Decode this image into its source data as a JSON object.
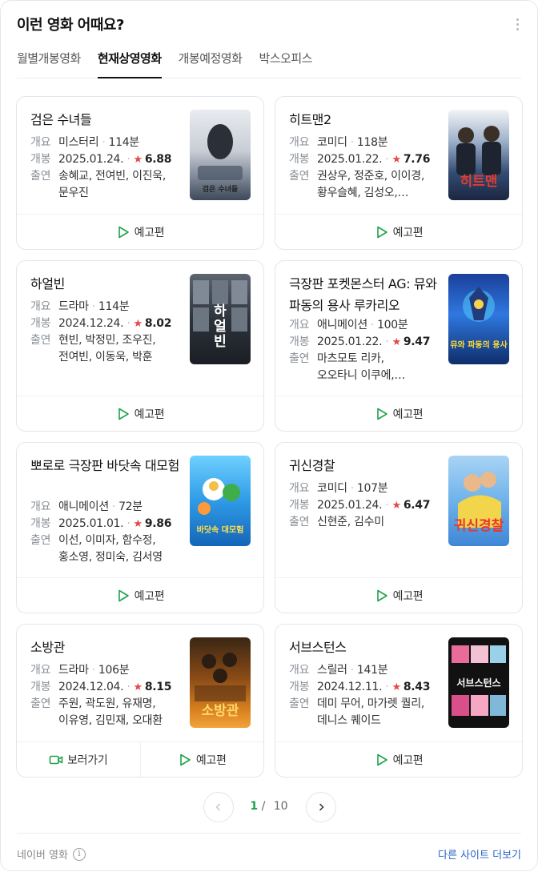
{
  "header": {
    "title": "이런 영화 어때요?",
    "more_icon": "kebab-icon"
  },
  "tabs": [
    {
      "label": "월별개봉영화",
      "active": false
    },
    {
      "label": "현재상영영화",
      "active": true
    },
    {
      "label": "개봉예정영화",
      "active": false
    },
    {
      "label": "박스오피스",
      "active": false
    }
  ],
  "labels": {
    "genre": "개요",
    "release": "개봉",
    "cast": "출연"
  },
  "movies": [
    {
      "title": "검은 수녀들",
      "genre": "미스터리",
      "runtime": "114분",
      "release": "2025.01.24.",
      "rating": "6.88",
      "cast": [
        "송혜교, 전여빈, 이진욱,",
        "문우진"
      ],
      "poster_text": "검은 수녀들",
      "poster_color": "#d9dde3",
      "trailer": "예고편"
    },
    {
      "title": "히트맨2",
      "genre": "코미디",
      "runtime": "118분",
      "release": "2025.01.22.",
      "rating": "7.76",
      "cast": [
        "권상우, 정준호, 이이경,",
        "황우슬혜, 김성오,…"
      ],
      "poster_text": "히트맨",
      "poster_color": "#1f3560",
      "trailer": "예고편"
    },
    {
      "title": "하얼빈",
      "genre": "드라마",
      "runtime": "114분",
      "release": "2024.12.24.",
      "rating": "8.02",
      "cast": [
        "현빈, 박정민, 조우진,",
        "전여빈, 이동욱, 박훈"
      ],
      "poster_text": "하얼빈",
      "poster_color": "#2a3038",
      "trailer": "예고편"
    },
    {
      "title": "극장판 포켓몬스터 AG: 뮤와 파동의 용사 루카리오",
      "genre": "애니메이션",
      "runtime": "100분",
      "release": "2025.01.22.",
      "rating": "9.47",
      "cast": [
        "마츠모토 리카,",
        "오오타니 이쿠에,…"
      ],
      "poster_text": "뮤와 파동의 용사",
      "poster_color": "#2e64c9",
      "trailer": "예고편"
    },
    {
      "title": "뽀로로 극장판 바닷속 대모험",
      "genre": "애니메이션",
      "runtime": "72분",
      "release": "2025.01.01.",
      "rating": "9.86",
      "cast": [
        "이선, 이미자, 함수정,",
        "홍소영, 정미숙, 김서영"
      ],
      "poster_text": "바닷속 대모험",
      "poster_color": "#3ea3e6",
      "trailer": "예고편"
    },
    {
      "title": "귀신경찰",
      "genre": "코미디",
      "runtime": "107분",
      "release": "2025.01.24.",
      "rating": "6.47",
      "cast": [
        "신현준, 김수미"
      ],
      "poster_text": "귀신경찰",
      "poster_color": "#7ab6ea",
      "trailer": "예고편"
    },
    {
      "title": "소방관",
      "genre": "드라마",
      "runtime": "106분",
      "release": "2024.12.04.",
      "rating": "8.15",
      "cast": [
        "주원, 곽도원, 유재명,",
        "이유영, 김민재, 오대환"
      ],
      "poster_text": "소방관",
      "poster_color": "#9a5a1e",
      "watch": "보러가기",
      "trailer": "예고편"
    },
    {
      "title": "서브스턴스",
      "genre": "스릴러",
      "runtime": "141분",
      "release": "2024.12.11.",
      "rating": "8.43",
      "cast": [
        "데미 무어, 마가렛 퀄리,",
        "데니스 퀘이드"
      ],
      "poster_text": "서브스턴스",
      "poster_color": "#111111",
      "trailer": "예고편"
    }
  ],
  "pagination": {
    "current": "1",
    "separator": "/",
    "total": "10"
  },
  "footer": {
    "source": "네이버 영화",
    "info_icon": "info-icon",
    "more_link": "다른 사이트 더보기"
  },
  "colors": {
    "accent_green": "#1fa24a",
    "star_red": "#e54848",
    "link_blue": "#2962c6"
  }
}
